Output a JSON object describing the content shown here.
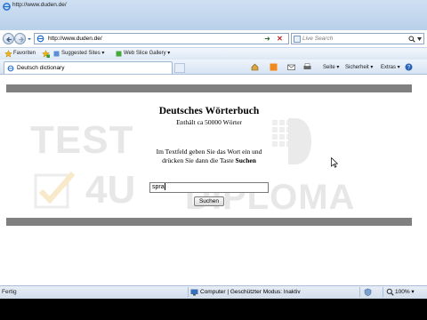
{
  "window": {
    "title": "http://www.duden.de/"
  },
  "navigation": {
    "url": "http://www.duden.de/"
  },
  "search": {
    "placeholder": "Live Search"
  },
  "favorites_bar": {
    "favorites_label": "Favoriten",
    "suggested_sites": "Suggested Sites ▾",
    "web_slice_gallery": "Web Slice Gallery ▾"
  },
  "tab": {
    "label": "Deutsch dictionary"
  },
  "command_bar": {
    "page_label": "Seite ▾",
    "safety_label": "Sicherheit ▾",
    "tools_label": "Extras ▾"
  },
  "page": {
    "heading": "Deutsches Wörterbuch",
    "subheading": "Enthält ca 50000 Wörter",
    "instruction_line1": "Im Textfeld geben Sie das Wort ein und",
    "instruction_line2_prefix": "drücken Sie dann die Taste ",
    "instruction_line2_bold": "Suchen",
    "input_value": "spra",
    "search_button": "Suchen"
  },
  "watermark": {
    "line1": "TEST",
    "line2": "4U",
    "line3": "DIPLOMA"
  },
  "status_bar": {
    "status": "Fertig",
    "zone": "Computer | Geschützter Modus: Inaktiv",
    "zoom": "100% ▾"
  },
  "colors": {
    "band": "#808080",
    "chrome_blue": "#d7e4f3"
  },
  "icons": [
    "ie-icon",
    "back-arrow-icon",
    "forward-arrow-icon",
    "page-icon",
    "go-arrow-icon",
    "stop-icon",
    "live-search-logo-icon",
    "search-icon",
    "favorites-star-icon",
    "add-favorite-icon",
    "suggested-sites-icon",
    "web-slice-icon",
    "tab-page-icon",
    "home-icon",
    "feeds-icon",
    "mail-icon",
    "print-icon",
    "help-icon",
    "globe-zone-icon",
    "zoom-icon",
    "mouse-pointer-icon"
  ]
}
